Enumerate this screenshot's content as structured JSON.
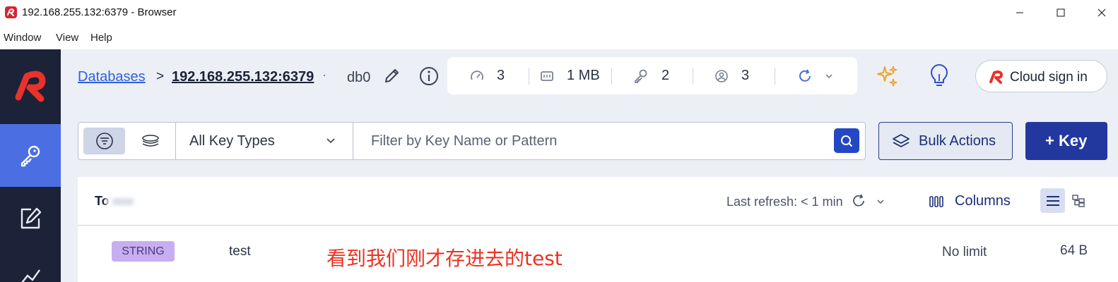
{
  "window": {
    "title": "192.168.255.132:6379 - Browser"
  },
  "menu": [
    "Window",
    "View",
    "Help"
  ],
  "breadcrumb": {
    "databases": "Databases",
    "separator": ">",
    "host": "192.168.255.132:6379",
    "db": "db0"
  },
  "stats": {
    "cpu": "3",
    "memory": "1 MB",
    "keys": "2",
    "clients": "3"
  },
  "header": {
    "cloud_sign_in": "Cloud sign in"
  },
  "filter": {
    "key_type": "All Key Types",
    "search_placeholder": "Filter by Key Name or Pattern"
  },
  "actions": {
    "bulk": "Bulk Actions",
    "add_key": "+ Key"
  },
  "results": {
    "total_label": "To",
    "last_refresh": "Last refresh: < 1 min",
    "columns": "Columns",
    "rows": [
      {
        "type": "STRING",
        "name": "test",
        "ttl": "No limit",
        "size": "64 B"
      }
    ]
  },
  "annotation": "看到我们刚才存进去的test",
  "colors": {
    "accent": "#2447c4",
    "nav_bg": "#1c2237",
    "nav_active": "#4b6ee3",
    "brand_red": "#e8322b",
    "annotation_red": "#ea3323",
    "string_badge": "#c7aef0"
  }
}
